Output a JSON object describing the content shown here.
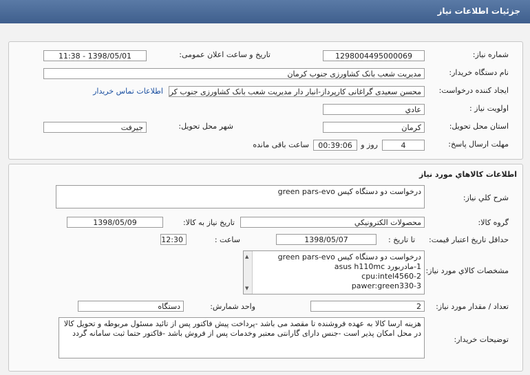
{
  "header": {
    "title": "جزئيات اطلاعات نياز"
  },
  "need": {
    "need_number_label": "شماره نياز:",
    "need_number": "1298004495000069",
    "announce_label": "تاريخ و ساعت اعلان عمومی:",
    "announce_value": "1398/05/01 - 11:38",
    "buyer_label": "نام دستگاه خريدار:",
    "buyer_value": "مديريت شعب بانک کشاورزی جنوب کرمان",
    "creator_label": "ايجاد کننده درخواست:",
    "creator_value": "محسن سعيدی گراغانی کارپرداز-انبار دار مديريت شعب بانک کشاورزی جنوب کر",
    "contact_link": "اطلاعات تماس خريدار",
    "priority_label": "اولويت نياز :",
    "priority_value": "عادي",
    "province_label": "استان محل تحويل:",
    "province_value": "کرمان",
    "city_label": "شهر محل تحويل:",
    "city_value": "جيرفت",
    "deadline_label": "مهلت ارسال پاسخ:",
    "days_value": "4",
    "days_and": "روز و",
    "time_value": "00:39:06",
    "remaining_label": "ساعت باقی مانده"
  },
  "goods": {
    "section_title": "اطلاعات کالاهاي مورد نياز",
    "summary_label": "شرح کلي نياز:",
    "summary_value": "درخواست دو دستگاه کيس green pars-evo",
    "group_label": "گروه کالا:",
    "group_value": "محصولات الکترونيکي",
    "need_date_label": "تاريخ نياز به کالا:",
    "need_date_value": "1398/05/09",
    "validity_label": "حداقل تاريخ اعتبار قيمت:",
    "until_date_label": "تا تاريخ :",
    "until_date_value": "1398/05/07",
    "hour_label": "ساعت :",
    "hour_value": "12:30",
    "spec_label": "مشخصات کالاي مورد نياز:",
    "spec_lines": [
      "درخواست دو دستگاه کيس green pars-evo",
      "1-مادربورد asus h110mc",
      "cpu:intel4560-2",
      "pawer:green330-3"
    ],
    "qty_label": "تعداد / مقدار مورد نياز:",
    "qty_value": "2",
    "unit_label": "واحد شمارش:",
    "unit_value": "دستگاه",
    "notes_label": "توضيحات خريدار:",
    "notes_value": "هزينه ارسا کالا به عهده فروشنده تا مقصد می باشد -پرداخت پيش فاکتور پس از تائيد مسئول مربوطه و تحويل کالا در محل امکان پذير است -جنس دارای گارانتی معتبر وخدمات پس از فروش باشد -فاکتور حتما ثبت سامانه گردد"
  }
}
